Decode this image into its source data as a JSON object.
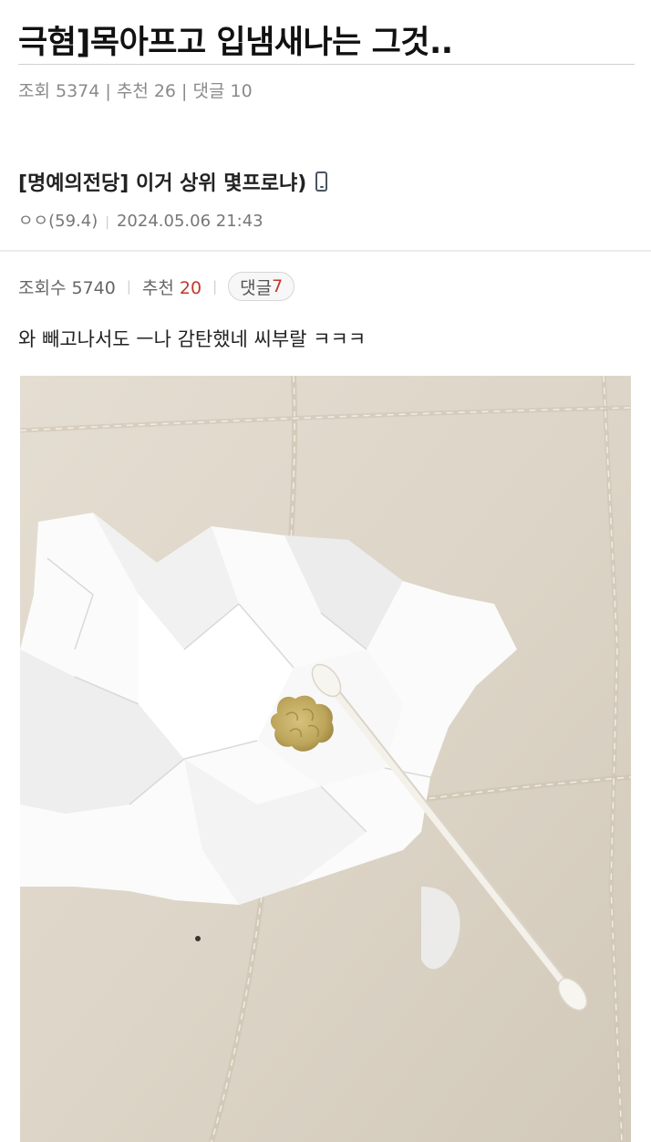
{
  "post": {
    "title": "극혐]목아프고 입냄새나는 그것..",
    "stats": "조회 5374 | 추천 26 | 댓글 10"
  },
  "quoted": {
    "title": "[명예의전당] 이거 상위 몇프로냐)",
    "author": "ㅇㅇ(59.4)",
    "datetime": "2024.05.06 21:43",
    "views_label": "조회수 5740",
    "recommend_label": "추천",
    "recommend_count": "20",
    "comments_label": "댓글",
    "comments_count": "7",
    "body": "와 빼고나서도 ㅡ나 감탄했네 씨부랄 ㅋㅋㅋ",
    "photo_icon": "mobile-phone-icon"
  },
  "colors": {
    "accent_red": "#c0392b",
    "muted_text": "#8a8a8a",
    "divider": "#cfcfcf"
  }
}
